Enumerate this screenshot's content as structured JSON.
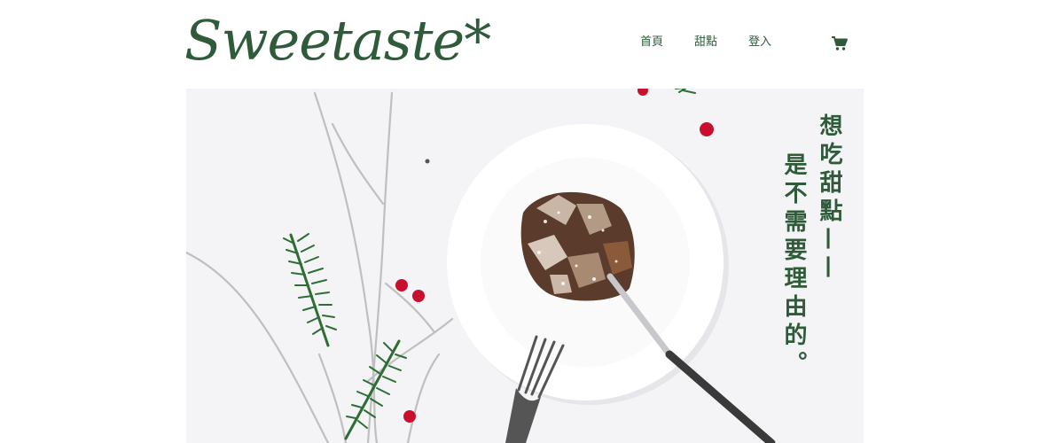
{
  "brand": {
    "logo_text": "Sweetaste*"
  },
  "nav": {
    "items": [
      "首頁",
      "甜點",
      "登入"
    ],
    "cart_icon": "cart-icon"
  },
  "hero": {
    "tagline_line1": "想吃甜點——",
    "tagline_line2": "是不需要理由的。"
  },
  "colors": {
    "brand_green": "#2f5b3a",
    "hero_bg": "#f4f4f6"
  }
}
